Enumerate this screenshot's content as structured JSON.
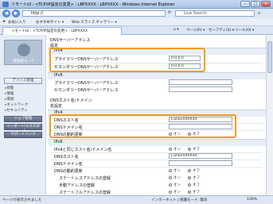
{
  "window": {
    "title": "リモートUI : <TCP/IP設定の変更> : LBPXXXX : LBPXXXX - Windows Internet Explorer"
  },
  "browser": {
    "address": "http://",
    "search_placeholder": "Live Search",
    "fav_label": "お気に入り",
    "fav_items": [
      "おすすめサイト ▾",
      "Web スライス ギャラリー ▾"
    ],
    "tab_label": "リモートUI : <TCP/IP設定の変更> : LBPXXXX",
    "tools": [
      "ページ(P) ▾",
      "セーフティ(S) ▾",
      "ツール(O) ▾"
    ]
  },
  "sidebar": {
    "mode": "管理者モード",
    "buttons": [
      "デバイス管理",
      "ジョブ管理",
      "インポート/エクスポート",
      "サポートリンク"
    ],
    "items": [
      "状態",
      "情報",
      "環境",
      "ネットワーク",
      "セキュリティ"
    ]
  },
  "form": {
    "dns_title": "DNSサーバーアドレス",
    "dns_sub": "設定",
    "ipv4": "IPv4",
    "ipv6": "IPv6",
    "primary": "プライマリーDNSサーバーアドレス",
    "secondary": "セカンダリーDNSサーバーアドレス",
    "primary_val": "0.0.0.0",
    "secondary_val": "0.0.0.0",
    "host_title": "DNSホスト名/ドメイン",
    "host_sub": "名設定",
    "hostname": "DNSホスト名",
    "domain": "DNSドメイン名",
    "dynamic": "DNSの動的更新",
    "host_val": "CanonXXXXXX",
    "on": "オン",
    "off": "オフ",
    "ipv6_same": "IPv4と同じホスト名/ドメイン名",
    "ipv6_host_val": "CanonXXXXXX",
    "stateless": "ステートレスアドレスの登録",
    "manual": "手動アドレスの登録",
    "stateful": "ステートフルアドレスの登録"
  },
  "status": {
    "left": "ページが表示されました",
    "zone": "インターネット | 保護モード: 無効",
    "zoom": "100%"
  }
}
